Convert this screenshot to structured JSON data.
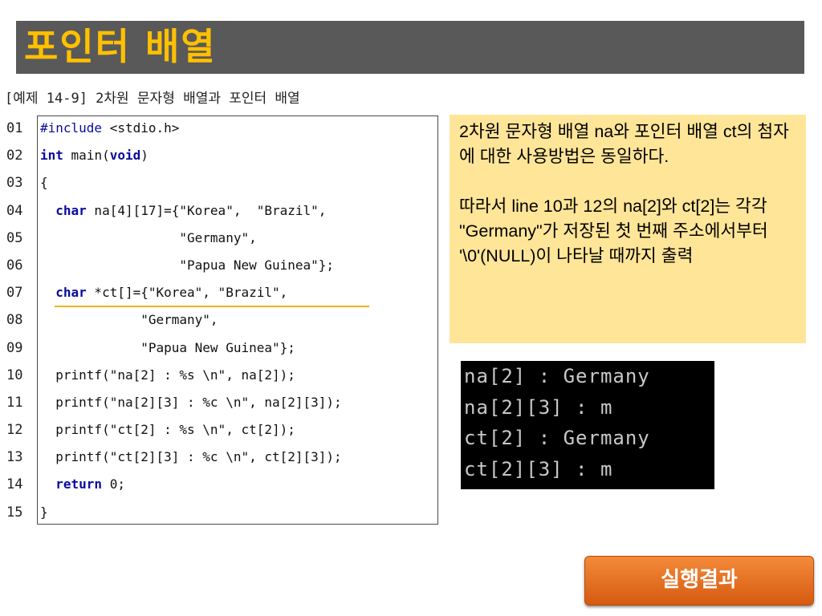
{
  "slide": {
    "title": "포인터 배열",
    "caption": "[예제 14-9] 2차원 문자형 배열과 포인터 배열"
  },
  "code": {
    "line_numbers": [
      "01",
      "02",
      "03",
      "04",
      "05",
      "06",
      "07",
      "08",
      "09",
      "10",
      "11",
      "12",
      "13",
      "14",
      "15"
    ],
    "lines": [
      [
        {
          "t": "#include",
          "c": "pp"
        },
        {
          "t": " <stdio.h>",
          "c": ""
        }
      ],
      [
        {
          "t": "int",
          "c": "kw"
        },
        {
          "t": " main(",
          "c": ""
        },
        {
          "t": "void",
          "c": "kw"
        },
        {
          "t": ")",
          "c": ""
        }
      ],
      [
        {
          "t": "{",
          "c": ""
        }
      ],
      [
        {
          "t": "  ",
          "c": ""
        },
        {
          "t": "char",
          "c": "kw"
        },
        {
          "t": " na[4][17]={\"Korea\",  \"Brazil\",",
          "c": ""
        }
      ],
      [
        {
          "t": "                  \"Germany\",",
          "c": ""
        }
      ],
      [
        {
          "t": "                  \"Papua New Guinea\"};",
          "c": ""
        }
      ],
      [
        {
          "t": "  ",
          "c": ""
        },
        {
          "t": "char",
          "c": "kw"
        },
        {
          "t": " *ct[]={\"Korea\", \"Brazil\",",
          "c": ""
        }
      ],
      [
        {
          "t": "             \"Germany\",",
          "c": ""
        }
      ],
      [
        {
          "t": "             \"Papua New Guinea\"};",
          "c": ""
        }
      ],
      [
        {
          "t": "  printf(\"na[2] : %s \\n\", na[2]);",
          "c": ""
        }
      ],
      [
        {
          "t": "  printf(\"na[2][3] : %c \\n\", na[2][3]);",
          "c": ""
        }
      ],
      [
        {
          "t": "  printf(\"ct[2] : %s \\n\", ct[2]);",
          "c": ""
        }
      ],
      [
        {
          "t": "  printf(\"ct[2][3] : %c \\n\", ct[2][3]);",
          "c": ""
        }
      ],
      [
        {
          "t": "  ",
          "c": ""
        },
        {
          "t": "return",
          "c": "kw"
        },
        {
          "t": " 0;",
          "c": ""
        }
      ],
      [
        {
          "t": "}",
          "c": ""
        }
      ]
    ]
  },
  "note": {
    "paragraph1": "2차원 문자형 배열 na와 포인터 배열 ct의 첨자에 대한 사용방법은 동일하다.",
    "paragraph2": "따라서 line 10과 12의 na[2]와 ct[2]는 각각 \"Germany\"가 저장된 첫 번째 주소에서부터 '\\0'(NULL)이 나타날 때까지 출력"
  },
  "console": {
    "lines": [
      "na[2] : Germany",
      "na[2][3] : m",
      "ct[2] : Germany",
      "ct[2][3] : m"
    ]
  },
  "run_button": {
    "label": "실행결과"
  },
  "colors": {
    "title_bar": "#595959",
    "title_text": "#ffc000",
    "note_bg": "#ffe597",
    "keyword": "#0a0aa0",
    "underline": "#f0b020",
    "button": "#e86a1e"
  }
}
